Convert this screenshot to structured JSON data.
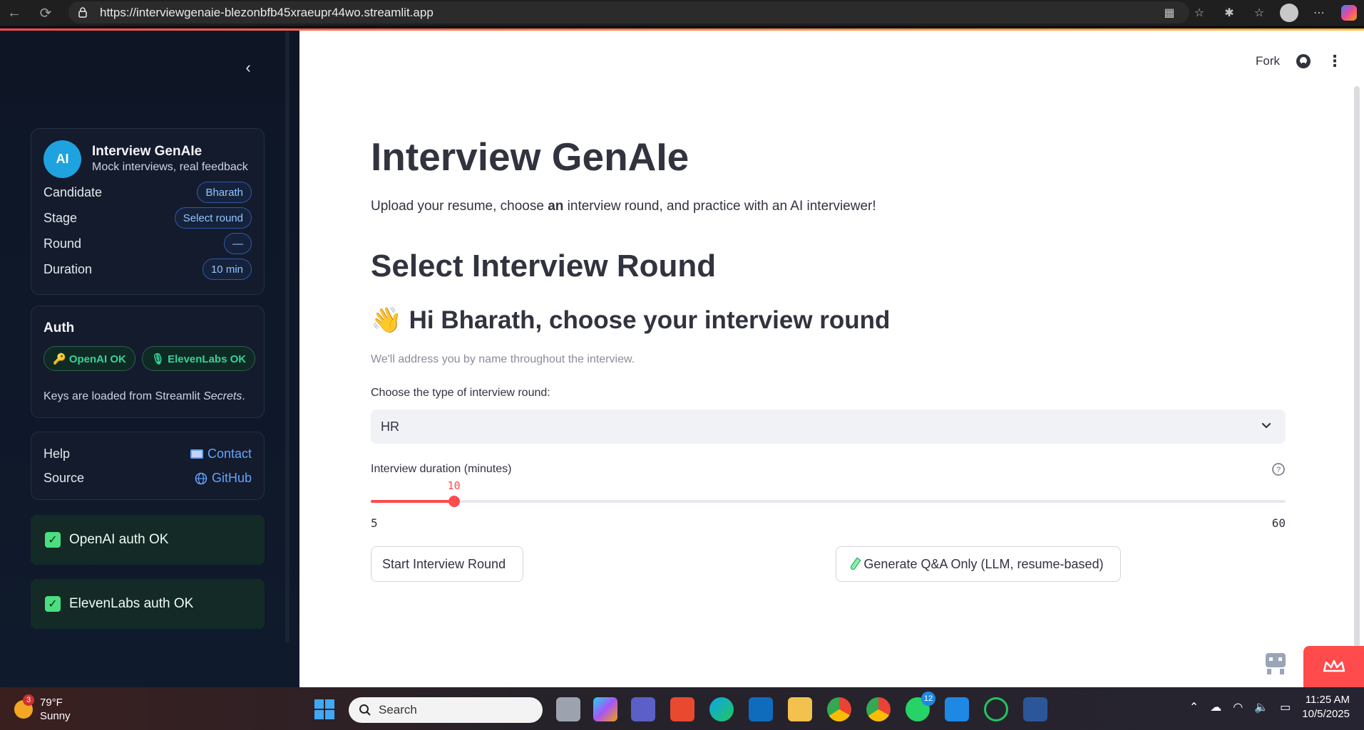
{
  "browser": {
    "url": "https://interviewgenaie-blezonbfb45xraeupr44wo.streamlit.app"
  },
  "sidebar": {
    "brand": {
      "avatar_text": "AI",
      "title": "Interview GenAIe",
      "subtitle": "Mock interviews, real feedback"
    },
    "details": [
      {
        "label": "Candidate",
        "value": "Bharath"
      },
      {
        "label": "Stage",
        "value": "Select round"
      },
      {
        "label": "Round",
        "value": "—"
      },
      {
        "label": "Duration",
        "value": "10 min"
      }
    ],
    "auth": {
      "title": "Auth",
      "openai_badge": "🔑 OpenAI OK",
      "elevenlabs_badge": "🎙 ElevenLabs OK",
      "note_prefix": "Keys are loaded from Streamlit ",
      "note_em": "Secrets",
      "note_suffix": "."
    },
    "help": {
      "help_label": "Help",
      "contact_text": "Contact",
      "source_label": "Source",
      "github_text": "GitHub"
    },
    "status": {
      "openai_ok": "OpenAI auth OK",
      "elevenlabs_ok": "ElevenLabs auth OK"
    }
  },
  "toolbar": {
    "fork_label": "Fork"
  },
  "main": {
    "title": "Interview GenAIe",
    "intro_before": "Upload your resume, choose ",
    "intro_bold": "an",
    "intro_after": " interview round, and practice with an AI interviewer!",
    "section_title": "Select Interview Round",
    "greeting_emoji": "👋",
    "greeting": "Hi Bharath, choose your interview round",
    "caption": "We'll address you by name throughout the interview.",
    "round_label": "Choose the type of interview round:",
    "round_selected": "HR",
    "duration_label": "Interview duration (minutes)",
    "duration": {
      "min": 5,
      "max": 60,
      "value": 10,
      "min_text": "5",
      "max_text": "60",
      "value_text": "10"
    },
    "start_button": "Start Interview Round",
    "generate_button": "Generate Q&A Only (LLM, resume-based)"
  },
  "taskbar": {
    "weather_temp": "79°F",
    "weather_desc": "Sunny",
    "weather_badge": "3",
    "search_placeholder": "Search",
    "whatsapp_badge": "12",
    "time": "11:25 AM",
    "date": "10/5/2025"
  },
  "colors": {
    "accent": "#ff4b4b",
    "sidebar_bg": "#0f172a",
    "success": "#34d399",
    "link": "#60a5fa"
  }
}
